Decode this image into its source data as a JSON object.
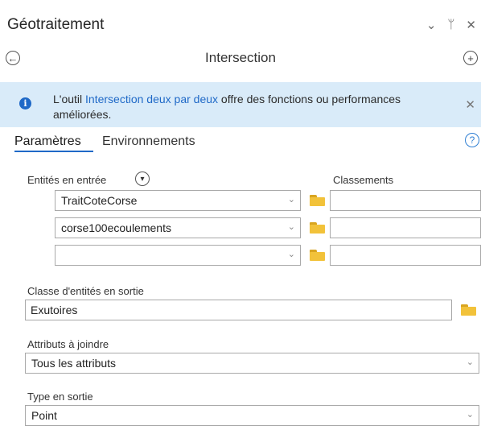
{
  "panel": {
    "title": "Géotraitement",
    "controls": {
      "minimize": "⌄",
      "pin": "ᛘ",
      "close": "✕"
    }
  },
  "header": {
    "tool_name": "Intersection",
    "back_icon": "arrow-left-circle-icon",
    "add_icon": "plus-circle-icon"
  },
  "info": {
    "text_before": "L'outil ",
    "link": "Intersection deux par deux",
    "text_after": " offre des fonctions ou performances améliorées.",
    "close": "✕"
  },
  "tabs": {
    "parameters": "Paramètres",
    "environments": "Environnements",
    "help": "?"
  },
  "inputs": {
    "label": "Entités en entrée",
    "ranks_label": "Classements",
    "rows": [
      {
        "value": "TraitCoteCorse"
      },
      {
        "value": "corse100ecoulements"
      },
      {
        "value": ""
      }
    ]
  },
  "output": {
    "label": "Classe d'entités en sortie",
    "value": "Exutoires"
  },
  "attributes": {
    "label": "Attributs à joindre",
    "value": "Tous les attributs"
  },
  "output_type": {
    "label": "Type en sortie",
    "value": "Point"
  },
  "colors": {
    "accent": "#1f69c7",
    "banner": "#d9ebf9",
    "folder": "#f2c23a"
  }
}
